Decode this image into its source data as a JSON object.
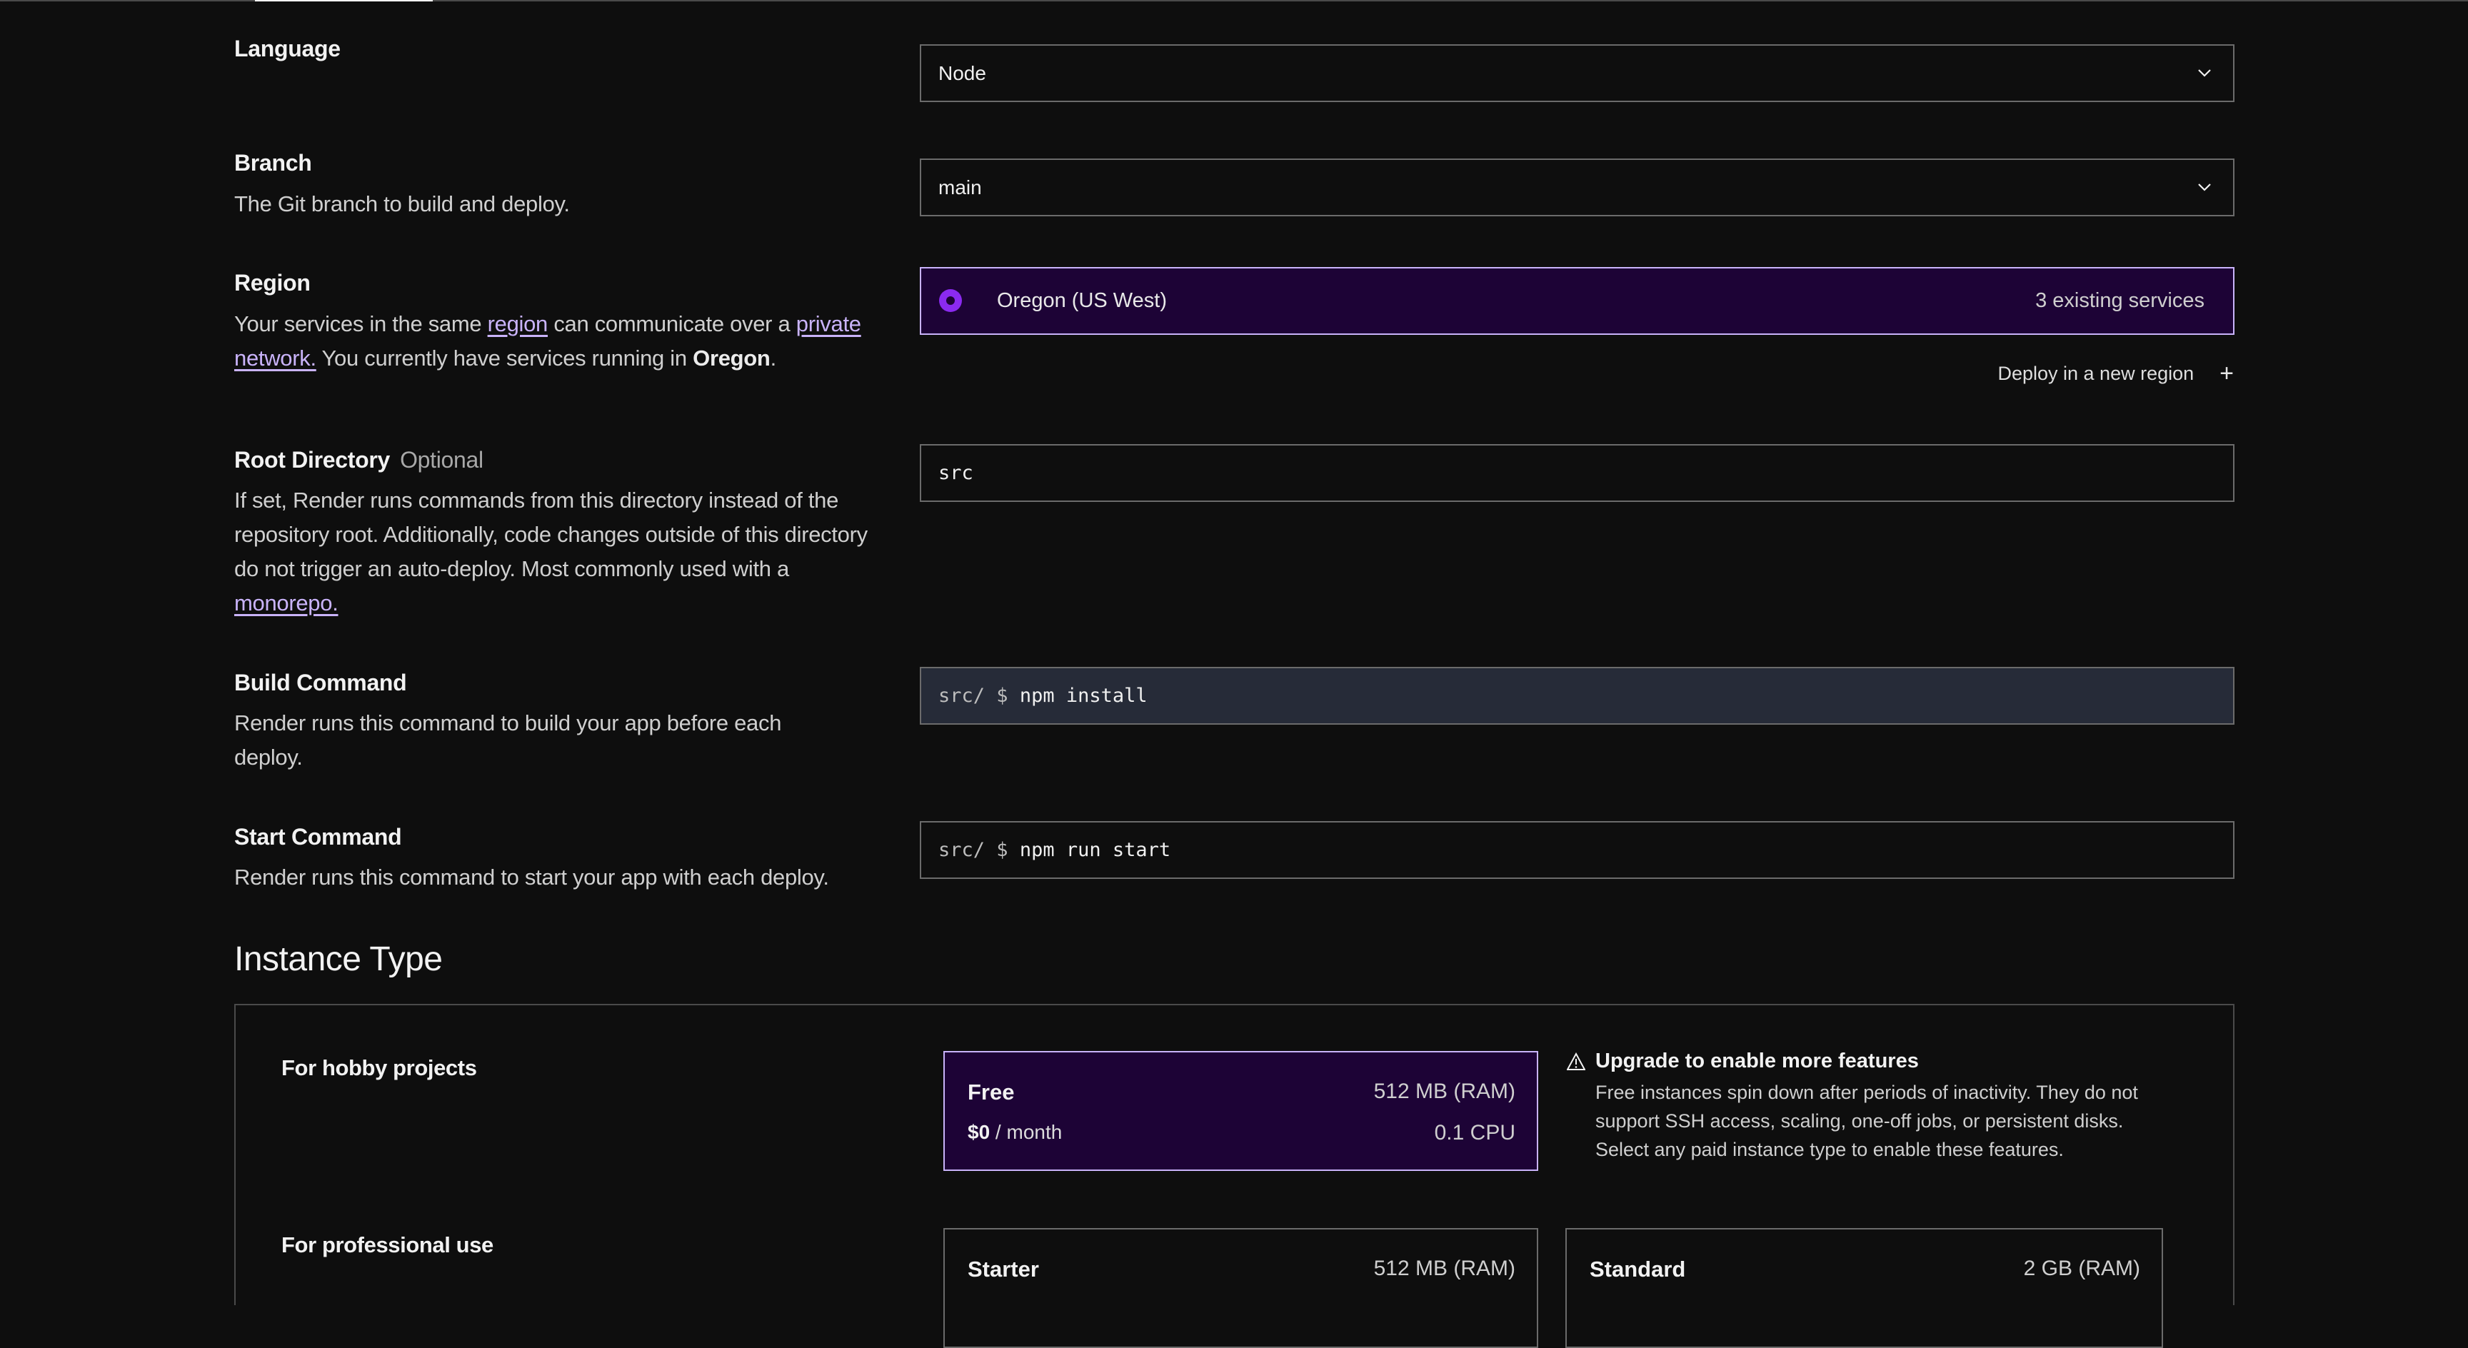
{
  "tabs_indicator": {
    "active": true
  },
  "language": {
    "label": "Language",
    "value": "Node"
  },
  "branch": {
    "label": "Branch",
    "description": "The Git branch to build and deploy.",
    "value": "main"
  },
  "region": {
    "label": "Region",
    "desc_part1": "Your services in the same ",
    "link_region": "region",
    "desc_part2": " can communicate over a ",
    "link_private_network": "private network.",
    "desc_part3": " You currently have services running in ",
    "current_region_bold": "Oregon",
    "desc_part4": ".",
    "selected_option": {
      "name": "Oregon (US West)",
      "count": "3 existing services"
    },
    "deploy_new_label": "Deploy in a new region",
    "deploy_new_icon": "+"
  },
  "root_directory": {
    "label": "Root Directory",
    "optional": "Optional",
    "description": "If set, Render runs commands from this directory instead of the repository root. Additionally, code changes outside of this directory do not trigger an auto-deploy. Most commonly used with a ",
    "link_monorepo": "monorepo.",
    "value": "src"
  },
  "build_command": {
    "label": "Build Command",
    "description": "Render runs this command to build your app before each deploy.",
    "prefix": "src/ $",
    "value": "npm install"
  },
  "start_command": {
    "label": "Start Command",
    "description": "Render runs this command to start your app with each deploy.",
    "prefix": "src/ $",
    "value": "npm run start"
  },
  "instance_type": {
    "title": "Instance Type",
    "hobby_label": "For hobby projects",
    "professional_label": "For professional use",
    "plans": [
      {
        "name": "Free",
        "ram": "512 MB (RAM)",
        "price": "$0",
        "period": " / month",
        "cpu": "0.1 CPU",
        "selected": true
      },
      {
        "name": "Starter",
        "ram": "512 MB (RAM)"
      },
      {
        "name": "Standard",
        "ram": "2 GB (RAM)"
      }
    ],
    "warning": {
      "icon": "warning-triangle",
      "title": "Upgrade to enable more features",
      "body": "Free instances spin down after periods of inactivity. They do not support SSH access, scaling, one-off jobs, or persistent disks. Select any paid instance type to enable these features."
    }
  },
  "colors": {
    "background": "#0e0e0e",
    "accent_border": "#c9b3fa",
    "selected_bg": "#1d0336",
    "radio": "#8b2af0",
    "link": "#c9b3fa",
    "field_border": "#6b6b6b",
    "filled_field_bg": "#262b38"
  }
}
